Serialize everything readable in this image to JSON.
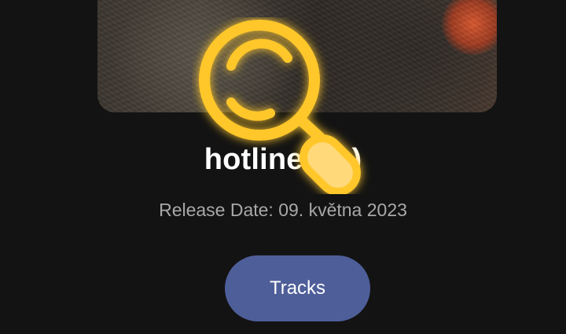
{
  "album": {
    "title": "hotline (…)",
    "release_date": "Release Date: 09. května 2023"
  },
  "actions": {
    "tracks_label": "Tracks"
  },
  "overlay": {
    "icon": "magnifier-icon",
    "color": "#ffc72a"
  },
  "colors": {
    "background": "#131313",
    "button": "#4e5e99",
    "secondary_text": "#a8a8a8"
  }
}
